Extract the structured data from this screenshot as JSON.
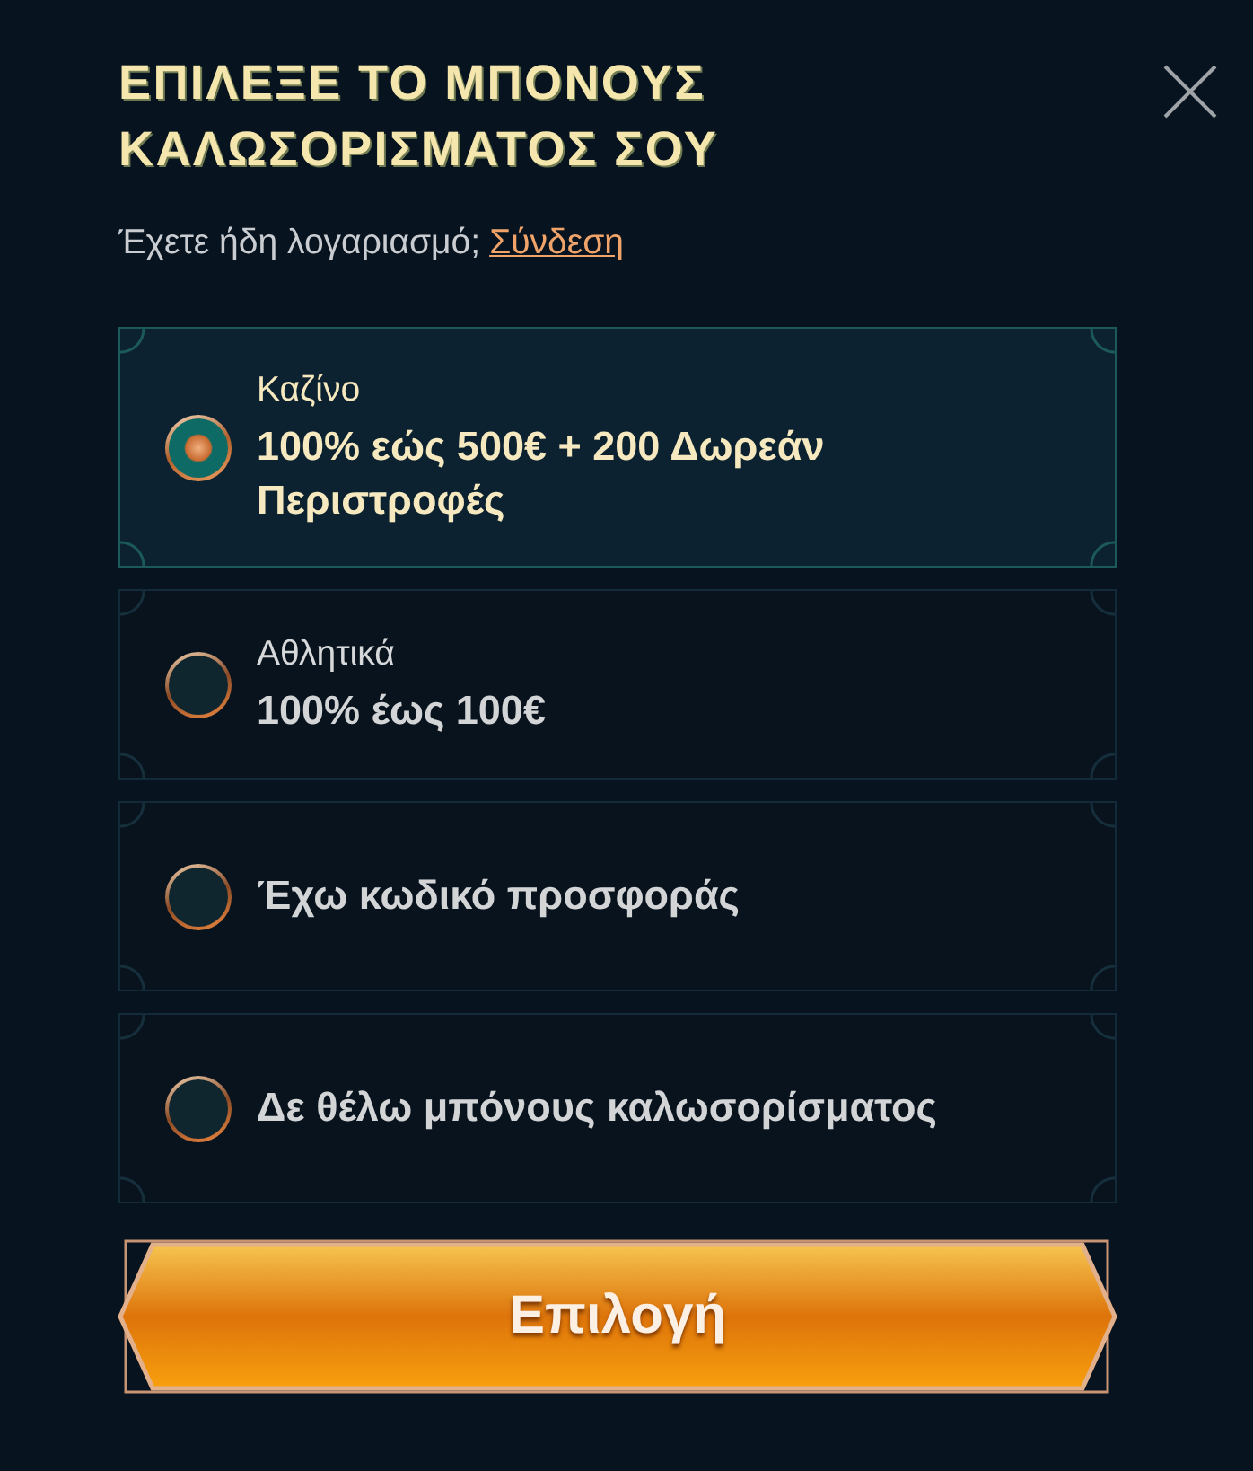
{
  "dialog": {
    "title": "ΕΠΙΛΕΞΕ ΤΟ ΜΠΟΝΟΥΣ ΚΑΛΩΣΟΡΙΣΜΑΤΟΣ ΣΟΥ"
  },
  "login_prompt": {
    "text": "Έχετε ήδη λογαριασμό;",
    "link": "Σύνδεση"
  },
  "options": [
    {
      "kind": "labeled",
      "category": "Καζίνο",
      "offer": "100% εώς 500€ + 200 Δωρεάν Περιστροφές",
      "selected": true
    },
    {
      "kind": "labeled",
      "category": "Αθλητικά",
      "offer": "100% έως 100€",
      "selected": false
    },
    {
      "kind": "plain",
      "offer": "Έχω κωδικό προσφοράς",
      "selected": false
    },
    {
      "kind": "plain",
      "offer": "Δε θέλω μπόνους καλωσορίσματος",
      "selected": false
    }
  ],
  "submit_button": {
    "label": "Επιλογή"
  }
}
